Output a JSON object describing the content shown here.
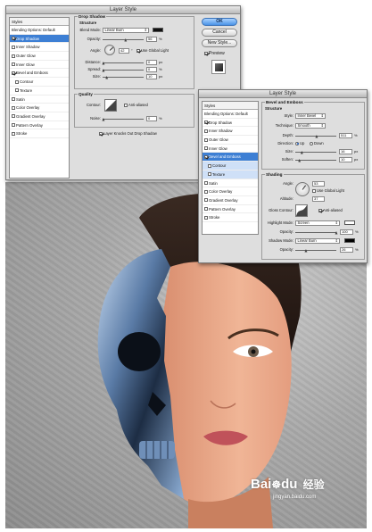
{
  "window_title": "Layer Style",
  "style_list": {
    "header": "Styles",
    "blending_options": "Blending Options: Default",
    "items": [
      {
        "label": "Drop Shadow",
        "checked": true
      },
      {
        "label": "Inner Shadow",
        "checked": false
      },
      {
        "label": "Outer Glow",
        "checked": false
      },
      {
        "label": "Inner Glow",
        "checked": false
      },
      {
        "label": "Bevel and Emboss",
        "checked": true
      },
      {
        "label": "Contour",
        "checked": false
      },
      {
        "label": "Texture",
        "checked": false
      },
      {
        "label": "Satin",
        "checked": false
      },
      {
        "label": "Color Overlay",
        "checked": false
      },
      {
        "label": "Gradient Overlay",
        "checked": false
      },
      {
        "label": "Pattern Overlay",
        "checked": false
      },
      {
        "label": "Stroke",
        "checked": false
      }
    ]
  },
  "drop_shadow": {
    "title": "Drop Shadow",
    "structure_title": "Structure",
    "blend_mode_label": "Blend Mode:",
    "blend_mode_value": "Linear Burn",
    "shadow_color": "#111111",
    "opacity_label": "Opacity:",
    "opacity_value": "56",
    "opacity_unit": "%",
    "angle_label": "Angle:",
    "angle_value": "42",
    "angle_unit": "°",
    "use_global_light": "Use Global Light",
    "distance_label": "Distance:",
    "distance_value": "0",
    "spread_label": "Spread:",
    "spread_value": "0",
    "size_label": "Size:",
    "size_value": "10",
    "px": "px",
    "quality_title": "Quality",
    "contour_label": "Contour:",
    "anti_aliased": "Anti-aliased",
    "noise_label": "Noise:",
    "noise_value": "0",
    "knockout": "Layer Knocks Out Drop Shadow"
  },
  "buttons": {
    "ok": "OK",
    "cancel": "Cancel",
    "new_style": "New Style...",
    "preview": "Preview"
  },
  "bevel": {
    "title": "Bevel and Emboss",
    "structure_title": "Structure",
    "style_label": "Style:",
    "style_value": "Inner Bevel",
    "technique_label": "Technique:",
    "technique_value": "Smooth",
    "depth_label": "Depth:",
    "depth_value": "511",
    "depth_unit": "%",
    "direction_label": "Direction:",
    "dir_up": "Up",
    "dir_down": "Down",
    "size_label": "Size:",
    "size_value": "16",
    "soften_label": "Soften:",
    "soften_value": "10",
    "px": "px",
    "shading_title": "Shading",
    "angle_label": "Angle:",
    "angle_value": "53",
    "use_global_light": "Use Global Light",
    "altitude_label": "Altitude:",
    "altitude_value": "37",
    "gloss_label": "Gloss Contour:",
    "anti_aliased": "Anti-aliased",
    "highlight_label": "Highlight Mode:",
    "highlight_value": "Screen",
    "highlight_color": "#ffffff",
    "h_opacity_label": "Opacity:",
    "h_opacity_value": "100",
    "shadow_label": "Shadow Mode:",
    "shadow_value": "Linear Burn",
    "shadow_color": "#000000",
    "s_opacity_label": "Opacity:",
    "s_opacity_value": "26",
    "pct": "%"
  },
  "watermark": {
    "brand": "Bai",
    "paw": "☸",
    "brand2": "du",
    "sub": "经验",
    "url": "jingyan.baidu.com"
  },
  "accent_color": "#3d7fd4"
}
